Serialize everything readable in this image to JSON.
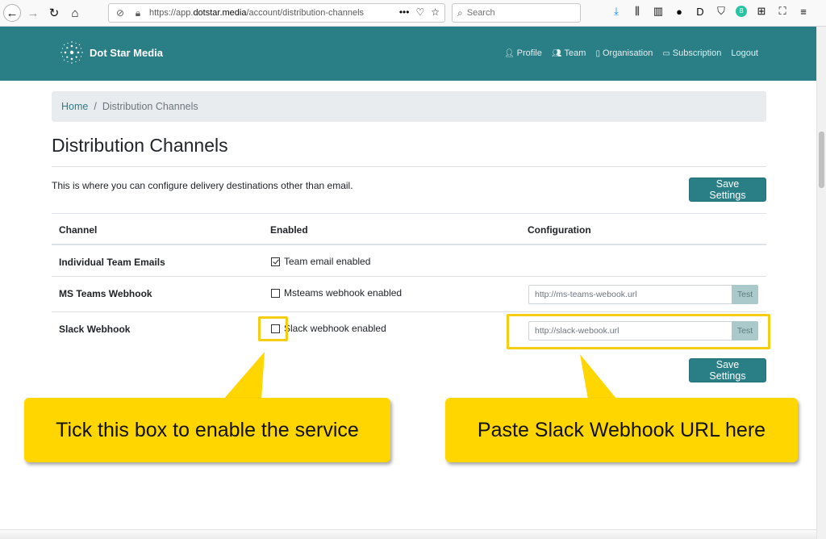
{
  "browser": {
    "url_prefix": "https://app.",
    "url_domain": "dotstar.media",
    "url_path": "/account/distribution-channels",
    "search_placeholder": "Search",
    "url_more": "•••"
  },
  "header": {
    "brand": "Dot Star Media",
    "nav": [
      {
        "label": "Profile",
        "icon": "user-icon"
      },
      {
        "label": "Team",
        "icon": "users-icon"
      },
      {
        "label": "Organisation",
        "icon": "building-icon"
      },
      {
        "label": "Subscription",
        "icon": "credit-card-icon"
      },
      {
        "label": "Logout",
        "icon": ""
      }
    ]
  },
  "breadcrumb": {
    "home": "Home",
    "separator": "/",
    "current": "Distribution Channels"
  },
  "page": {
    "title": "Distribution Channels",
    "intro": "This is where you can configure delivery destinations other than email.",
    "save_label": "Save Settings"
  },
  "table": {
    "headers": [
      "Channel",
      "Enabled",
      "Configuration"
    ],
    "rows": [
      {
        "channel": "Individual Team Emails",
        "enabled_label": "Team email enabled",
        "checked": true
      },
      {
        "channel": "MS Teams Webhook",
        "enabled_label": "Msteams webhook enabled",
        "checked": false,
        "placeholder": "http://ms-teams-webook.url",
        "test_label": "Test"
      },
      {
        "channel": "Slack Webhook",
        "enabled_label": "Slack webhook enabled",
        "checked": false,
        "placeholder": "http://slack-webook.url",
        "test_label": "Test"
      }
    ]
  },
  "annotations": {
    "left": "Tick this box to enable the service",
    "right": "Paste Slack Webhook URL here"
  },
  "colors": {
    "brand": "#2a7f86",
    "callout": "#ffd600",
    "highlight": "#f5cd12"
  }
}
